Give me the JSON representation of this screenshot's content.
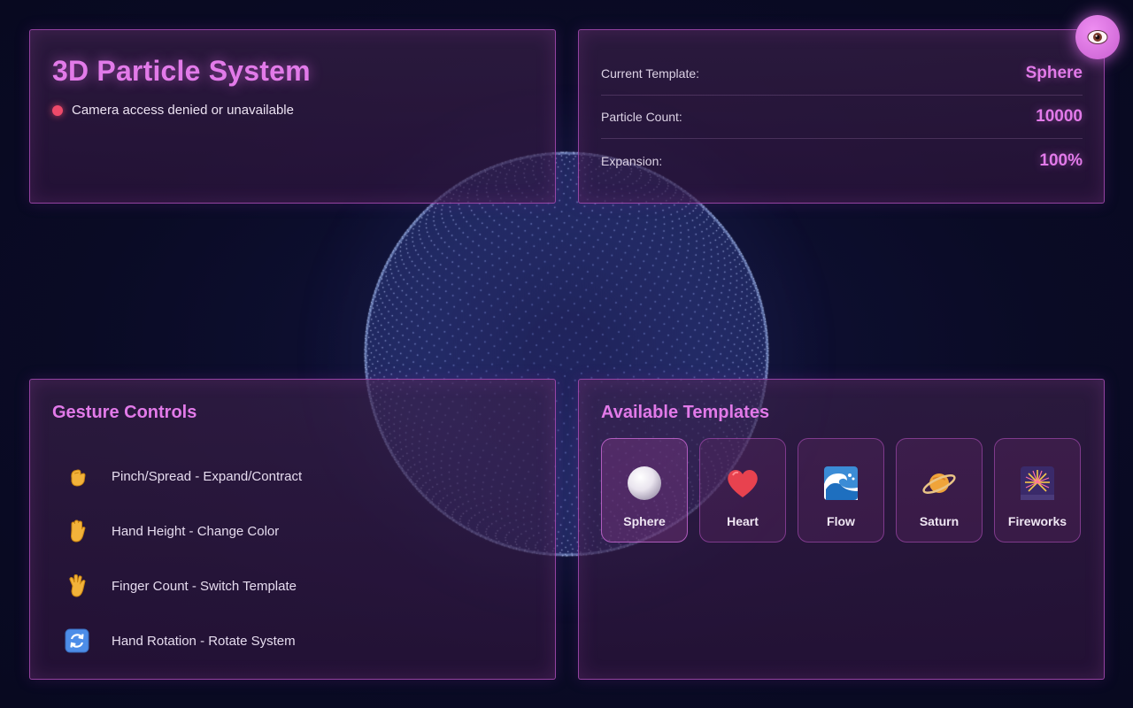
{
  "header": {
    "title": "3D Particle System",
    "status_text": "Camera access denied or unavailable",
    "status_color": "#ee4a6a"
  },
  "info": {
    "rows": [
      {
        "label": "Current Template:",
        "value": "Sphere"
      },
      {
        "label": "Particle Count:",
        "value": "10000"
      },
      {
        "label": "Expansion:",
        "value": "100%"
      }
    ]
  },
  "toggle": {
    "icon": "eye-icon"
  },
  "gestures": {
    "title": "Gesture Controls",
    "items": [
      {
        "icon": "pinch-hand-icon",
        "text": "Pinch/Spread - Expand/Contract"
      },
      {
        "icon": "raised-hand-icon",
        "text": "Hand Height - Change Color"
      },
      {
        "icon": "spread-fingers-icon",
        "text": "Finger Count - Switch Template"
      },
      {
        "icon": "rotate-arrows-icon",
        "text": "Hand Rotation - Rotate System"
      }
    ]
  },
  "templates": {
    "title": "Available Templates",
    "items": [
      {
        "icon": "sphere-icon",
        "label": "Sphere",
        "active": true
      },
      {
        "icon": "heart-icon",
        "label": "Heart",
        "active": false
      },
      {
        "icon": "wave-icon",
        "label": "Flow",
        "active": false
      },
      {
        "icon": "saturn-icon",
        "label": "Saturn",
        "active": false
      },
      {
        "icon": "fireworks-icon",
        "label": "Fireworks",
        "active": false
      }
    ]
  },
  "colors": {
    "accent": "#e27ae9",
    "particle": "#8fa8ff",
    "background": "#0b0c26"
  }
}
